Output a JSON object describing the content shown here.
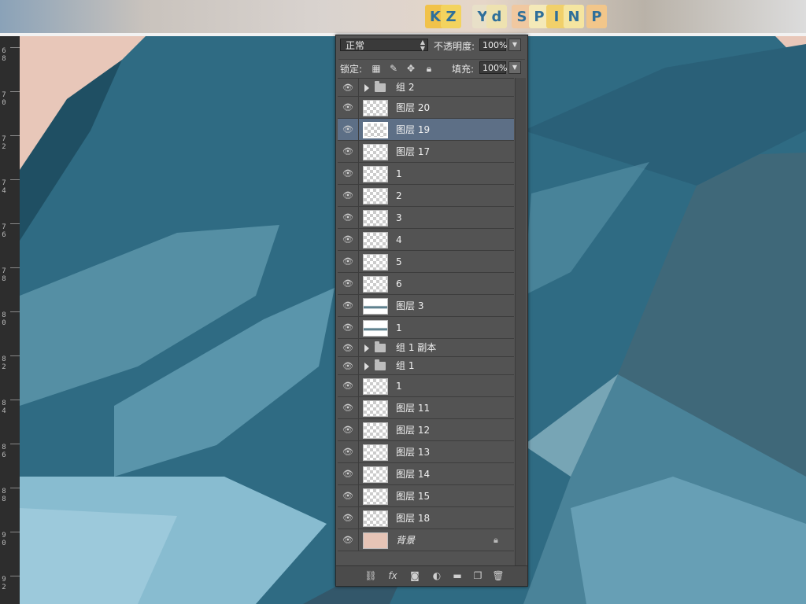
{
  "photo_strip": {
    "blocks": [
      "K",
      "Z",
      "Y",
      "d",
      "S",
      "P",
      "I",
      "N",
      "P"
    ]
  },
  "ruler": {
    "ticks": [
      "6 8",
      "7 0",
      "7 2",
      "7 4",
      "7 6",
      "7 8",
      "8 0",
      "8 2",
      "8 4",
      "8 6",
      "8 8",
      "9 0",
      "9 2"
    ]
  },
  "panel": {
    "blend_mode": "正常",
    "opacity_label": "不透明度:",
    "opacity_value": "100%",
    "lock_label": "锁定:",
    "fill_label": "填充:",
    "fill_value": "100%",
    "layers": [
      {
        "name": "组 2",
        "type": "group"
      },
      {
        "name": "图层 20",
        "type": "layer"
      },
      {
        "name": "图层 19",
        "type": "layer",
        "selected": true
      },
      {
        "name": "图层 17",
        "type": "layer"
      },
      {
        "name": "1",
        "type": "layer"
      },
      {
        "name": "2",
        "type": "layer"
      },
      {
        "name": "3",
        "type": "layer"
      },
      {
        "name": "4",
        "type": "layer"
      },
      {
        "name": "5",
        "type": "layer"
      },
      {
        "name": "6",
        "type": "layer"
      },
      {
        "name": "图层 3",
        "type": "layer",
        "thumb": "dark"
      },
      {
        "name": "1",
        "type": "layer",
        "thumb": "dark"
      },
      {
        "name": "组 1 副本",
        "type": "group"
      },
      {
        "name": "组 1",
        "type": "group"
      },
      {
        "name": "1",
        "type": "layer"
      },
      {
        "name": "图层 11",
        "type": "layer"
      },
      {
        "name": "图层 12",
        "type": "layer"
      },
      {
        "name": "图层 13",
        "type": "layer"
      },
      {
        "name": "图层 14",
        "type": "layer"
      },
      {
        "name": "图层 15",
        "type": "layer"
      },
      {
        "name": "图层 18",
        "type": "layer"
      },
      {
        "name": "背景",
        "type": "background",
        "locked": true
      }
    ],
    "footer_icons": [
      "link-icon",
      "fx-icon",
      "mask-icon",
      "adjustment-icon",
      "folder-icon",
      "new-layer-icon",
      "trash-icon"
    ]
  },
  "colors": {
    "panel_bg": "#535353",
    "selected_row": "#5d6f86",
    "canvas_blue": "#2e6c84"
  }
}
